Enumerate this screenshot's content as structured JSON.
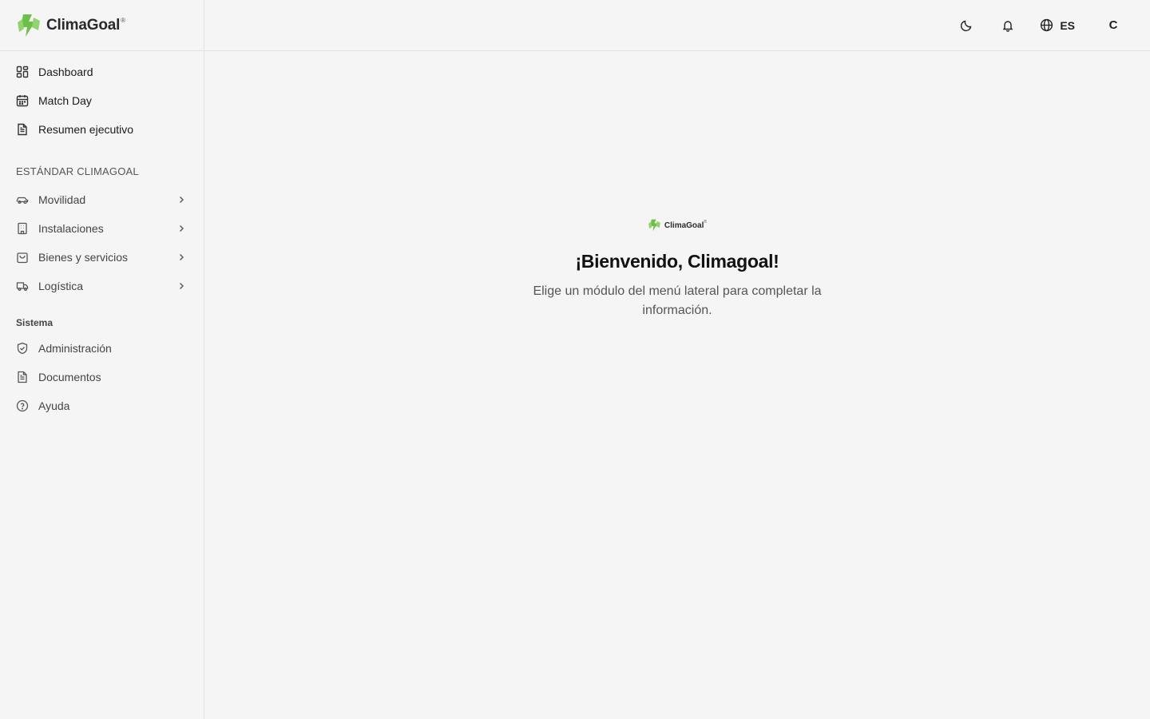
{
  "brand": {
    "name": "ClimaGoal",
    "reg": "®",
    "accent": "#6cc04a"
  },
  "nav_primary": [
    {
      "label": "Dashboard",
      "icon": "dashboard-grid-icon"
    },
    {
      "label": "Match Day",
      "icon": "calendar-icon"
    },
    {
      "label": "Resumen ejecutivo",
      "icon": "document-icon"
    }
  ],
  "section_standard": {
    "title": "ESTÁNDAR CLIMAGOAL"
  },
  "nav_standard": [
    {
      "label": "Movilidad",
      "icon": "car-icon"
    },
    {
      "label": "Instalaciones",
      "icon": "building-icon"
    },
    {
      "label": "Bienes y servicios",
      "icon": "shopping-bag-icon"
    },
    {
      "label": "Logística",
      "icon": "truck-icon"
    }
  ],
  "section_system": {
    "title": "Sistema"
  },
  "nav_system": [
    {
      "label": "Administración",
      "icon": "shield-check-icon"
    },
    {
      "label": "Documentos",
      "icon": "document-icon"
    },
    {
      "label": "Ayuda",
      "icon": "help-circle-icon"
    }
  ],
  "topbar": {
    "language": "ES",
    "avatar_initial": "C"
  },
  "welcome": {
    "logo_text": "ClimaGoal",
    "logo_reg": "®",
    "title": "¡Bienvenido, Climagoal!",
    "subtitle": "Elige un módulo del menú lateral para completar la información."
  }
}
